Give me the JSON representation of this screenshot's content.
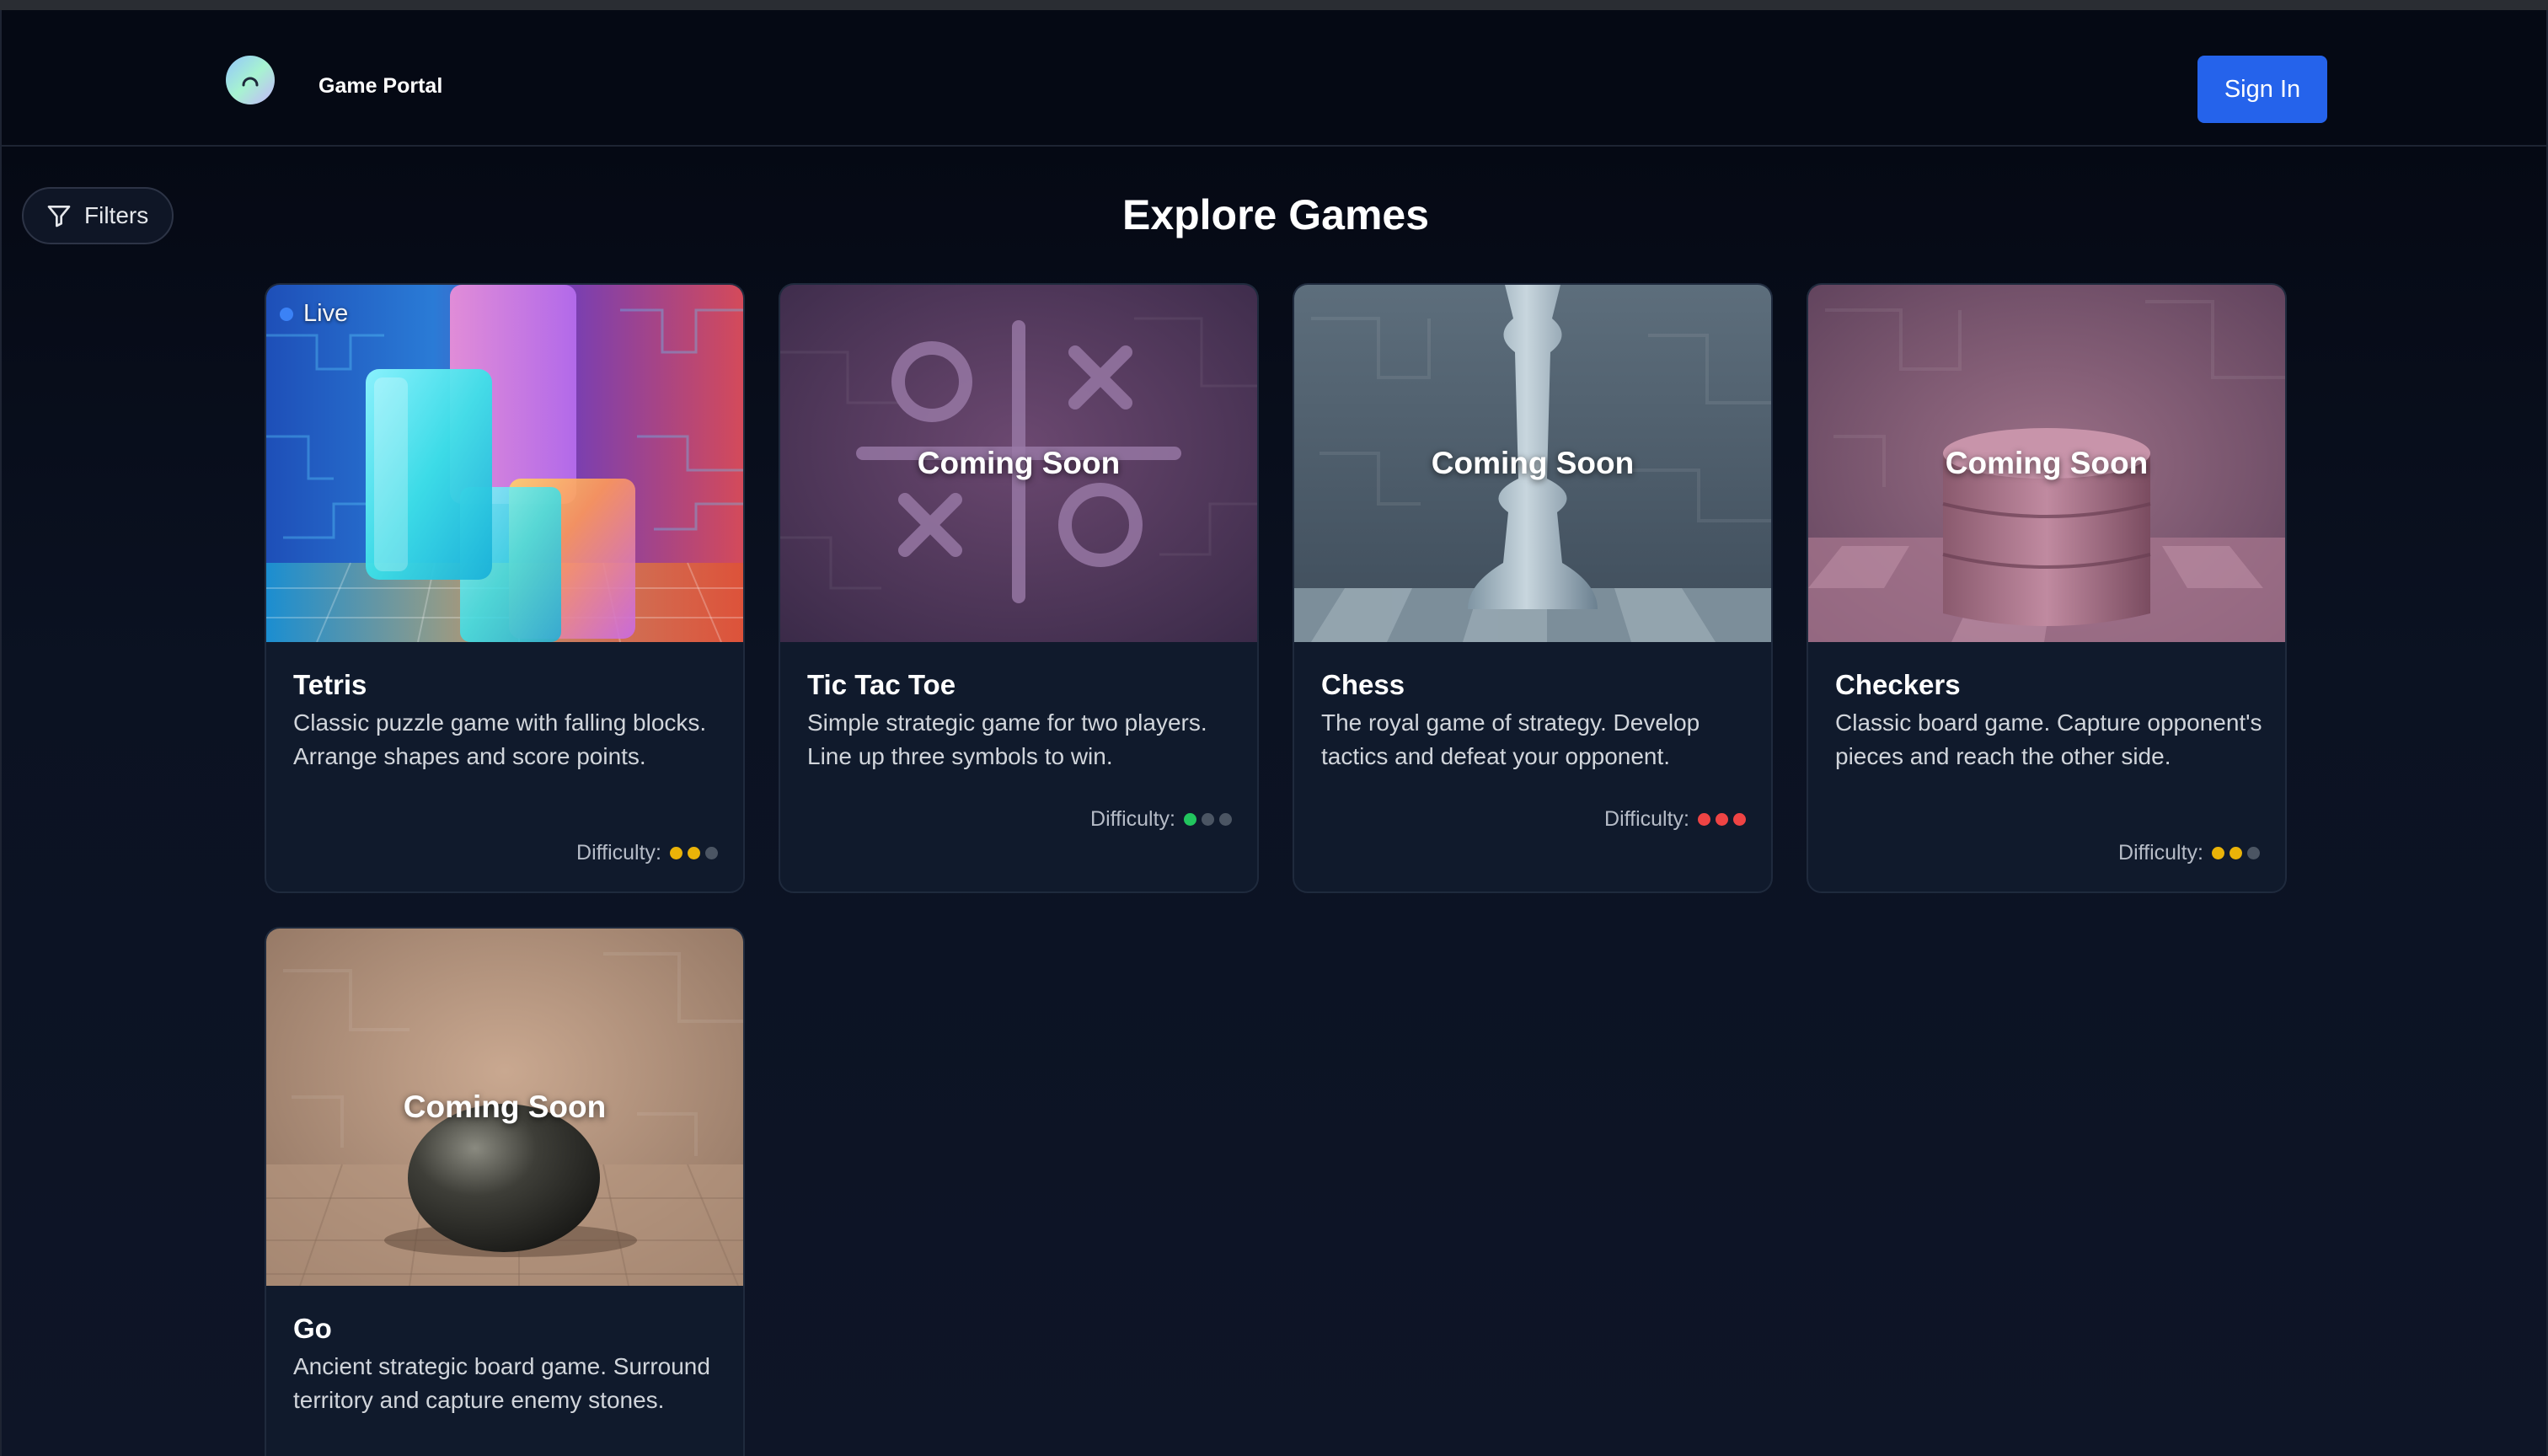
{
  "header": {
    "brand": "Game Portal",
    "logo_icon": "portal-logo-icon",
    "signin_label": "Sign In"
  },
  "toolbar": {
    "filters_label": "Filters",
    "filters_icon": "filter-icon"
  },
  "page": {
    "title": "Explore Games"
  },
  "colors": {
    "accent": "#2563eb",
    "live_dot": "#3b82f6",
    "diff_easy": "#22c55e",
    "diff_medium": "#eab308",
    "diff_hard": "#ef4444",
    "diff_off": "#4b5563"
  },
  "difficulty_label": "Difficulty:",
  "games": [
    {
      "name": "Tetris",
      "description": "Classic puzzle game with falling blocks. Arrange shapes and score points.",
      "status": "Live",
      "difficulty": 2,
      "difficulty_color": "#eab308"
    },
    {
      "name": "Tic Tac Toe",
      "description": "Simple strategic game for two players. Line up three symbols to win.",
      "status": "Coming Soon",
      "difficulty": 1,
      "difficulty_color": "#22c55e"
    },
    {
      "name": "Chess",
      "description": "The royal game of strategy. Develop tactics and defeat your opponent.",
      "status": "Coming Soon",
      "difficulty": 3,
      "difficulty_color": "#ef4444"
    },
    {
      "name": "Checkers",
      "description": "Classic board game. Capture opponent's pieces and reach the other side.",
      "status": "Coming Soon",
      "difficulty": 2,
      "difficulty_color": "#eab308"
    },
    {
      "name": "Go",
      "description": "Ancient strategic board game. Surround territory and capture enemy stones.",
      "status": "Coming Soon"
    }
  ]
}
